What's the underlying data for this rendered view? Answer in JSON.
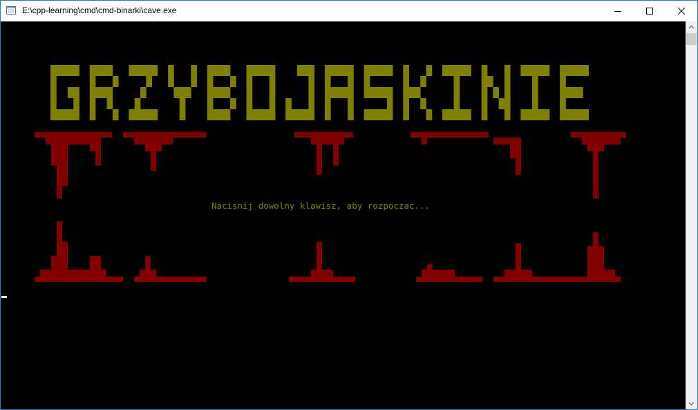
{
  "window": {
    "title": "E:\\cpp-learning\\cmd\\cmd-binarki\\cave.exe",
    "icon": "console-app-icon",
    "controls": [
      "minimize-icon",
      "maximize-icon",
      "close-icon"
    ]
  },
  "console": {
    "game_title": "GRZYBOJASKINIE",
    "prompt": "Nacisnij dowolny klawisz, aby rozpoczac...",
    "colors": {
      "background": "#000000",
      "title": "#808000",
      "stalactites": "#800000",
      "prompt": "#808000",
      "cursor": "#ffffff"
    }
  }
}
